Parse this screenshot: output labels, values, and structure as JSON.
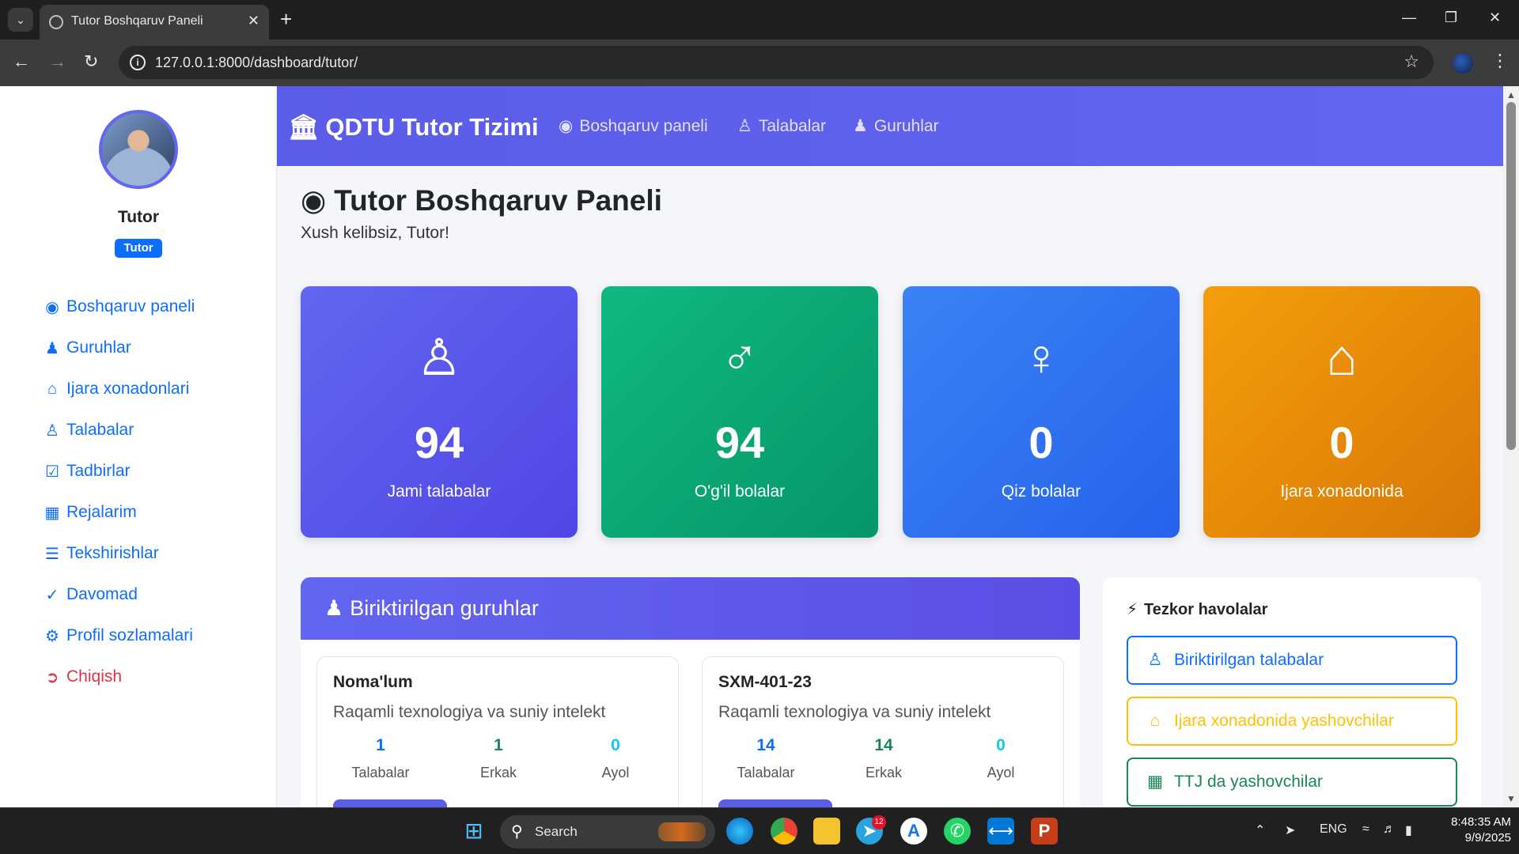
{
  "browser": {
    "tab_title": "Tutor Boshqaruv Paneli",
    "url": "127.0.0.1:8000/dashboard/tutor/"
  },
  "sidebar": {
    "user_name": "Tutor",
    "role_badge": "Tutor",
    "items": [
      {
        "label": "Boshqaruv paneli",
        "icon": "dashboard-icon"
      },
      {
        "label": "Guruhlar",
        "icon": "users-icon"
      },
      {
        "label": "Ijara xonadonlari",
        "icon": "home-icon"
      },
      {
        "label": "Talabalar",
        "icon": "student-icon"
      },
      {
        "label": "Tadbirlar",
        "icon": "calendar-check-icon"
      },
      {
        "label": "Rejalarim",
        "icon": "calendar-icon"
      },
      {
        "label": "Tekshirishlar",
        "icon": "clipboard-list-icon"
      },
      {
        "label": "Davomad",
        "icon": "clipboard-check-icon"
      },
      {
        "label": "Profil sozlamalari",
        "icon": "user-cog-icon"
      },
      {
        "label": "Chiqish",
        "icon": "logout-icon"
      }
    ]
  },
  "navbar": {
    "brand": "QDTU Tutor Tizimi",
    "links": [
      {
        "label": "Boshqaruv paneli"
      },
      {
        "label": "Talabalar"
      },
      {
        "label": "Guruhlar"
      }
    ]
  },
  "page": {
    "title": "Tutor Boshqaruv Paneli",
    "welcome": "Xush kelibsiz, Tutor!"
  },
  "stats": [
    {
      "value": "94",
      "label": "Jami talabalar",
      "icon": "graduate-icon",
      "color_from": "#6366f1",
      "color_to": "#5046e5"
    },
    {
      "value": "94",
      "label": "O'g'il bolalar",
      "icon": "male-icon",
      "color_from": "#10b981",
      "color_to": "#059669"
    },
    {
      "value": "0",
      "label": "Qiz bolalar",
      "icon": "female-icon",
      "color_from": "#3b82f6",
      "color_to": "#2563eb"
    },
    {
      "value": "0",
      "label": "Ijara xonadonida",
      "icon": "house-icon",
      "color_from": "#f59e0b",
      "color_to": "#d97706"
    }
  ],
  "groups": {
    "header": "Biriktirilgan guruhlar",
    "cards": [
      {
        "name": "Noma'lum",
        "desc": "Raqamli texnologiya va suniy intelekt",
        "stats": [
          {
            "value": "1",
            "label": "Talabalar",
            "color": "#0d6efd"
          },
          {
            "value": "1",
            "label": "Erkak",
            "color": "#198754"
          },
          {
            "value": "0",
            "label": "Ayol",
            "color": "#0dcaf0"
          }
        ]
      },
      {
        "name": "SXM-401-23",
        "desc": "Raqamli texnologiya va suniy intelekt",
        "stats": [
          {
            "value": "14",
            "label": "Talabalar",
            "color": "#0d6efd"
          },
          {
            "value": "14",
            "label": "Erkak",
            "color": "#198754"
          },
          {
            "value": "0",
            "label": "Ayol",
            "color": "#0dcaf0"
          }
        ]
      }
    ]
  },
  "quick_links": {
    "title": "Tezkor havolalar",
    "items": [
      {
        "label": "Biriktirilgan talabalar",
        "color": "#0d6efd",
        "icon": "student-icon"
      },
      {
        "label": "Ijara xonadonida yashovchilar",
        "color": "#ffc107",
        "icon": "home-icon"
      },
      {
        "label": "TTJ da yashovchilar",
        "color": "#198754",
        "icon": "building-icon"
      }
    ]
  },
  "taskbar": {
    "search_label": "Search",
    "telegram_badge": "12",
    "lang": "ENG",
    "time": "8:48:35 AM",
    "date": "9/9/2025"
  }
}
